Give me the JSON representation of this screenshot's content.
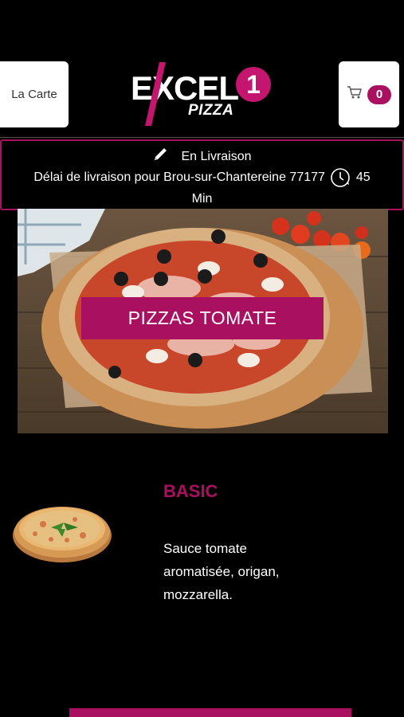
{
  "header": {
    "menu_label": "La Carte",
    "cart_count": "0",
    "logo": {
      "main": "EXCEL",
      "number": "1",
      "sub": "PIZZA"
    }
  },
  "delivery": {
    "mode_label": "En Livraison",
    "delay_text": "Délai de livraison pour Brou-sur-Chantereine 77177",
    "delay_value": "45",
    "delay_unit": "Min"
  },
  "category": {
    "label": "PIZZAS TOMATE"
  },
  "products": [
    {
      "name": "BASIC",
      "description": "Sauce tomate aromatisée, origan, mozzarella."
    }
  ],
  "colors": {
    "accent": "#a9105f",
    "background": "#000000",
    "surface": "#ffffff"
  },
  "icons": {
    "edit": "pencil-icon",
    "cart": "cart-icon",
    "clock": "clock-icon"
  }
}
